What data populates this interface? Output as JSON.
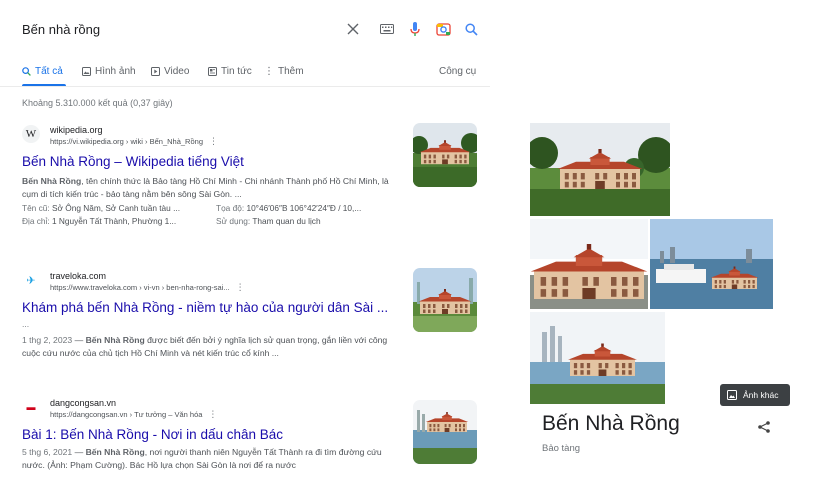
{
  "search": {
    "query": "Bến nhà rồng"
  },
  "tabs": [
    {
      "label": "Tất cả",
      "icon": "search-icon",
      "active": true
    },
    {
      "label": "Hình ảnh",
      "icon": "image-icon"
    },
    {
      "label": "Video",
      "icon": "video-icon"
    },
    {
      "label": "Tin tức",
      "icon": "news-icon"
    },
    {
      "label": "Thêm",
      "icon": "more-icon"
    }
  ],
  "tools_label": "Công cụ",
  "result_stats": "Khoảng 5.310.000 kết quả (0,37 giây)",
  "results": [
    {
      "source_name": "wikipedia.org",
      "source_url": "https://vi.wikipedia.org › wiki › Bến_Nhà_Rồng",
      "favicon": "W",
      "title": "Bến Nhà Rồng – Wikipedia tiếng Việt",
      "snippet_bold": "Bến Nhà Rồng",
      "snippet": ", tên chính thức là Bảo tàng Hồ Chí Minh - Chi nhánh Thành phố Hồ Chí Minh, là cụm di tích kiến trúc - bảo tàng nằm bên sông Sài Gòn. ...",
      "attributes": [
        {
          "label": "Tên cũ:",
          "value": "Sở Ông Năm, Sở Canh tuần tàu ..."
        },
        {
          "label": "Tọa độ:",
          "value": "10°46′06″B 106°42′24″Đ / 10,..."
        },
        {
          "label": "Địa chỉ:",
          "value": "1 Nguyễn Tất Thành, Phường 1..."
        },
        {
          "label": "Sử dụng:",
          "value": "Tham quan du lịch"
        }
      ]
    },
    {
      "source_name": "traveloka.com",
      "source_url": "https://www.traveloka.com › vi-vn › ben-nha-rong-sai...",
      "favicon": "✈",
      "title": "Khám phá bến Nhà Rồng - niềm tự hào của người dân Sài ...",
      "date": "1 thg 2, 2023",
      "snippet_bold": "Bến Nhà Rồng",
      "snippet": " được biết đến bởi ý nghĩa lịch sử quan trọng, gắn liền với công cuộc cứu nước của chủ tịch Hồ Chí Minh và nét kiến trúc cổ kính ..."
    },
    {
      "source_name": "dangcongsan.vn",
      "source_url": "https://dangcongsan.vn › Tư tưởng – Văn hóa",
      "favicon": "▬",
      "title": "Bài 1: Bến Nhà Rồng - Nơi in dấu chân Bác",
      "date": "5 thg 6, 2021",
      "snippet_bold": "Bến Nhà Rồng",
      "snippet": ", nơi người thanh niên Nguyễn Tất Thành ra đi tìm đường cứu nước. (Ảnh: Phạm Cường). Bác Hồ lựa chọn Sài Gòn là nơi để ra nước"
    }
  ],
  "knowledge_panel": {
    "title": "Bến Nhà Rồng",
    "subtitle": "Bảo tàng",
    "more_photos_label": "Ảnh khác"
  },
  "colors": {
    "link": "#1a0dab",
    "accent": "#1a73e8",
    "building_roof": "#b5452b",
    "building_wall": "#e8c9a8"
  }
}
